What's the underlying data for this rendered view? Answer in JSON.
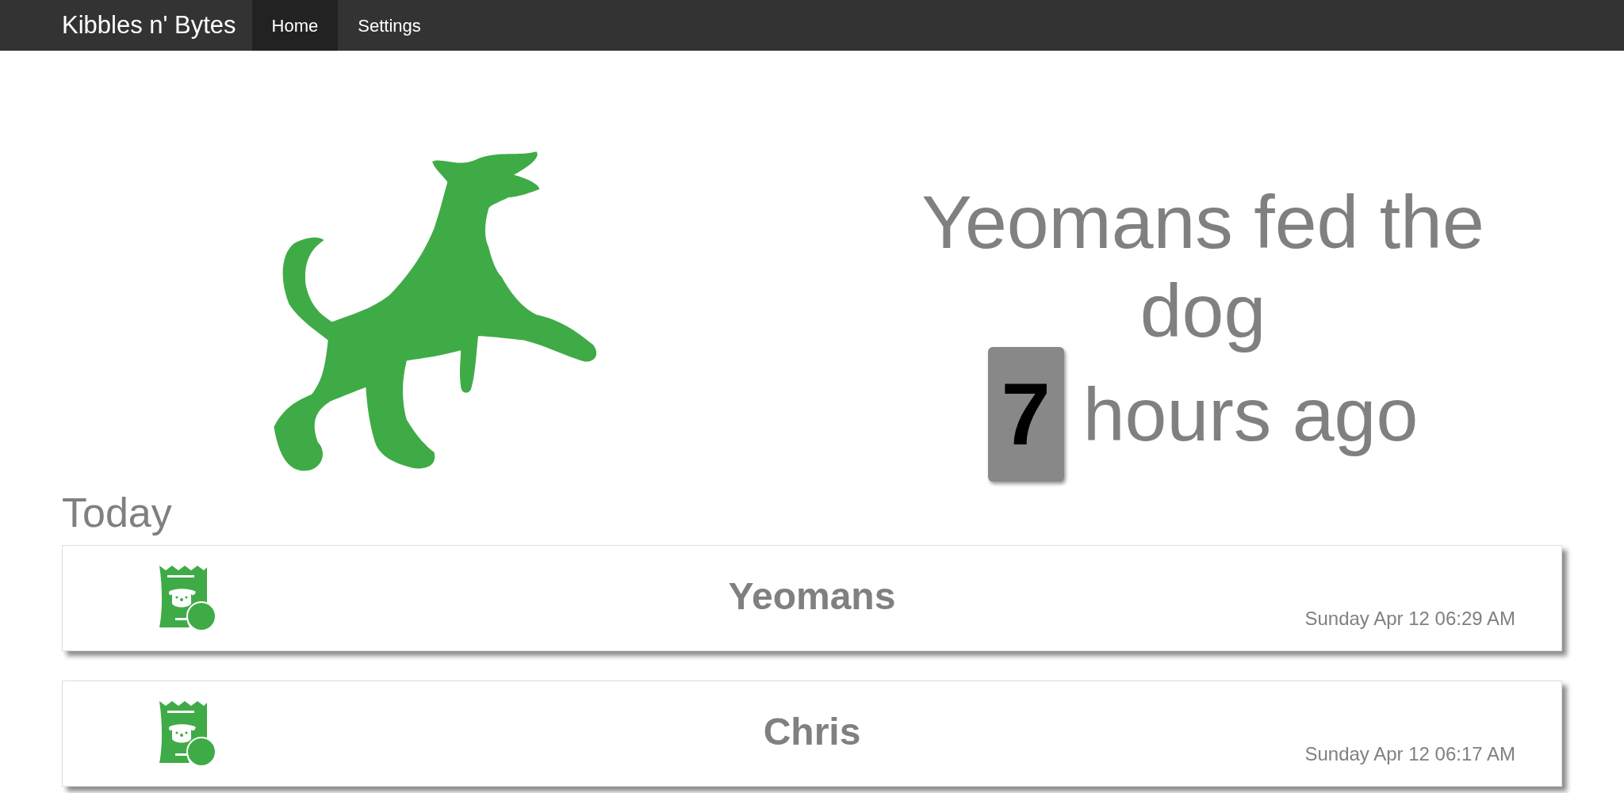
{
  "navbar": {
    "brand": "Kibbles n' Bytes",
    "tabs": [
      {
        "label": "Home",
        "selected": true
      },
      {
        "label": "Settings",
        "selected": false
      }
    ]
  },
  "status": {
    "headline": "Yeomans fed the dog",
    "count": "7",
    "unit": "hours ago"
  },
  "section_title": "Today",
  "feedings": [
    {
      "name": "Yeomans",
      "time": "Sunday Apr 12 06:29 AM"
    },
    {
      "name": "Chris",
      "time": "Sunday Apr 12 06:17 AM"
    }
  ]
}
